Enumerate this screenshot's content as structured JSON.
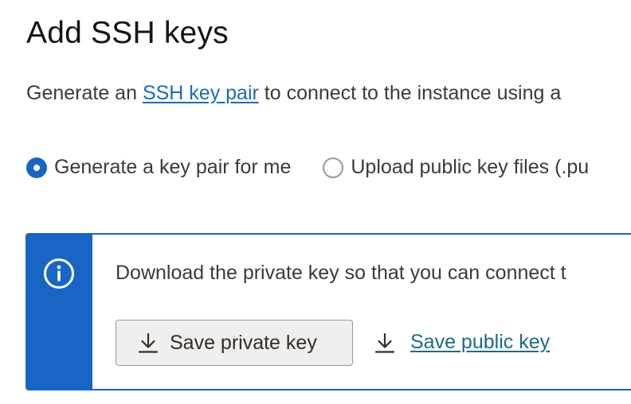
{
  "header": {
    "title": "Add SSH keys"
  },
  "description": {
    "prefix": "Generate an ",
    "link_text": "SSH key pair",
    "suffix": " to connect to the instance using a"
  },
  "key_options": {
    "selected": "generate",
    "items": [
      {
        "id": "generate",
        "label": "Generate a key pair for me",
        "checked": true
      },
      {
        "id": "upload",
        "label": "Upload public key files (.pu",
        "checked": false
      }
    ]
  },
  "notice": {
    "icon": "info-icon",
    "text": "Download the private key so that you can connect t",
    "accent_color": "#1865c6",
    "save_private_label": "Save private key",
    "save_public_label": "Save public key",
    "download_icon": "download-icon"
  }
}
